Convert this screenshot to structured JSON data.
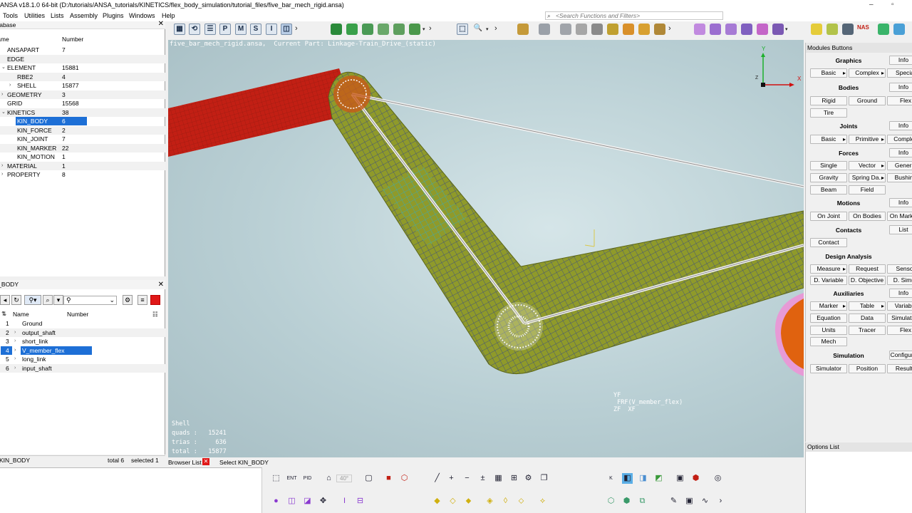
{
  "titlebar": {
    "title": "ANSA v18.1.0 64-bit (D:/tutorials/ANSA_tutorials/KINETICS/flex_body_simulation/tutorial_files/five_bar_mech_rigid.ansa)",
    "minimize": "–",
    "maximize": "▫",
    "close": "✕"
  },
  "menu": [
    "Tools",
    "Utilities",
    "Lists",
    "Assembly",
    "Plugins",
    "Windows",
    "Help"
  ],
  "search": {
    "placeholder": "<Search Functions and Filters>"
  },
  "database_browser": {
    "header": "Database",
    "col_name": "Name",
    "col_number": "Number",
    "rows": [
      {
        "name": "ANSAPART",
        "number": "7"
      },
      {
        "name": "EDGE",
        "number": ""
      },
      {
        "name": "ELEMENT",
        "number": "15881"
      },
      {
        "name": "RBE2",
        "number": "4"
      },
      {
        "name": "SHELL",
        "number": "15877"
      },
      {
        "name": "GEOMETRY",
        "number": "3"
      },
      {
        "name": "GRID",
        "number": "15568"
      },
      {
        "name": "KINETICS",
        "number": "38"
      },
      {
        "name": "KIN_BODY",
        "number": "6"
      },
      {
        "name": "KIN_FORCE",
        "number": "2"
      },
      {
        "name": "KIN_JOINT",
        "number": "7"
      },
      {
        "name": "KIN_MARKER",
        "number": "22"
      },
      {
        "name": "KIN_MOTION",
        "number": "1"
      },
      {
        "name": "MATERIAL",
        "number": "1"
      },
      {
        "name": "PROPERTY",
        "number": "8"
      }
    ]
  },
  "body_list": {
    "header": "KIN_BODY",
    "col_name": "Name",
    "col_number": "Number",
    "items": [
      {
        "num": "1",
        "name": "Ground"
      },
      {
        "num": "2",
        "name": "output_shaft"
      },
      {
        "num": "3",
        "name": "short_link"
      },
      {
        "num": "4",
        "name": "V_member_flex"
      },
      {
        "num": "5",
        "name": "long_link"
      },
      {
        "num": "6",
        "name": "input_shaft"
      }
    ],
    "status_left": "KIN_BODY",
    "status_total": "total 6",
    "status_selected": "selected 1"
  },
  "viewport": {
    "header": "five_bar_mech_rigid.ansa,  Current Part: Linkage-Train_Drive_(static)",
    "stats_title": "Shell",
    "quads_label": "quads :",
    "quads": "15241",
    "trias_label": "trias :",
    "trias": "636",
    "total_label": "total :",
    "total": "15877",
    "frf_yf": "YF",
    "frf_label": "FRF(V_member_flex)",
    "frf_zf": "ZF  XF",
    "axis_x": "X",
    "axis_y": "Y",
    "axis_z": "Z"
  },
  "modules": {
    "header": "Modules Buttons",
    "sections": [
      {
        "title": "Graphics",
        "info": "Info",
        "buttons": [
          [
            "Basic",
            "Complex",
            "Special"
          ]
        ]
      },
      {
        "title": "Bodies",
        "info": "Info",
        "buttons": [
          [
            "Rigid",
            "Ground",
            "Flex"
          ],
          [
            "Tire"
          ]
        ]
      },
      {
        "title": "Joints",
        "info": "Info",
        "buttons": [
          [
            "Basic",
            "Primitive",
            "Complex"
          ]
        ]
      },
      {
        "title": "Forces",
        "info": "Info",
        "buttons": [
          [
            "Single",
            "Vector",
            "General"
          ],
          [
            "Gravity",
            "Spring Da..",
            "Bushing"
          ],
          [
            "Beam",
            "Field"
          ]
        ]
      },
      {
        "title": "Motions",
        "info": "Info",
        "buttons": [
          [
            "On Joint",
            "On Bodies",
            "On Markers"
          ]
        ]
      },
      {
        "title": "Contacts",
        "info": "List",
        "buttons": [
          [
            "Contact"
          ]
        ]
      },
      {
        "title": "Design Analysis",
        "info": "",
        "buttons": [
          [
            "Measure",
            "Request",
            "Sensor"
          ],
          [
            "D. Variable",
            "D. Objective",
            "D. Simul."
          ]
        ]
      },
      {
        "title": "Auxiliaries",
        "info": "Info",
        "buttons": [
          [
            "Marker",
            "Table",
            "Variable"
          ],
          [
            "Equation",
            "Data",
            "Simulation"
          ],
          [
            "Units",
            "Tracer",
            "Flex"
          ],
          [
            "Mech"
          ]
        ]
      },
      {
        "title": "Simulation",
        "info": "Configure",
        "buttons": [
          [
            "Simulator",
            "Position",
            "Results"
          ]
        ]
      }
    ]
  },
  "options_list": {
    "header": "Options List"
  },
  "bottom": {
    "browser_list": "Browser List",
    "select_label": "Select KIN_BODY",
    "angle": "40°"
  },
  "toolbar": {
    "p_label": "P",
    "m_label": "M",
    "s_label": "S",
    "i_label": "I",
    "nas_label": "NAS"
  },
  "colors": {
    "red_part": "#c21f14",
    "mesh_olive": "#8f9a2a",
    "mesh_blue": "#2c3f92",
    "selection_blue": "#1d6fd6",
    "orange_part": "#e0620f",
    "pink_part": "#e79ad6"
  }
}
